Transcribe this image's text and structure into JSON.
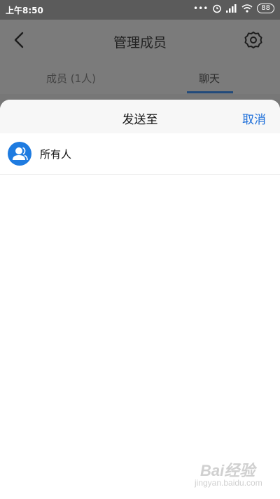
{
  "status_bar": {
    "time": "上午8:50",
    "battery": "88"
  },
  "header": {
    "title": "管理成员"
  },
  "tabs": [
    {
      "label": "成员 (1人)"
    },
    {
      "label": "聊天"
    }
  ],
  "sheet": {
    "title": "发送至",
    "cancel_label": "取消",
    "items": [
      {
        "label": "所有人"
      }
    ]
  },
  "watermark": {
    "line1": "Bai经验",
    "line2": "jingyan.baidu.com"
  }
}
